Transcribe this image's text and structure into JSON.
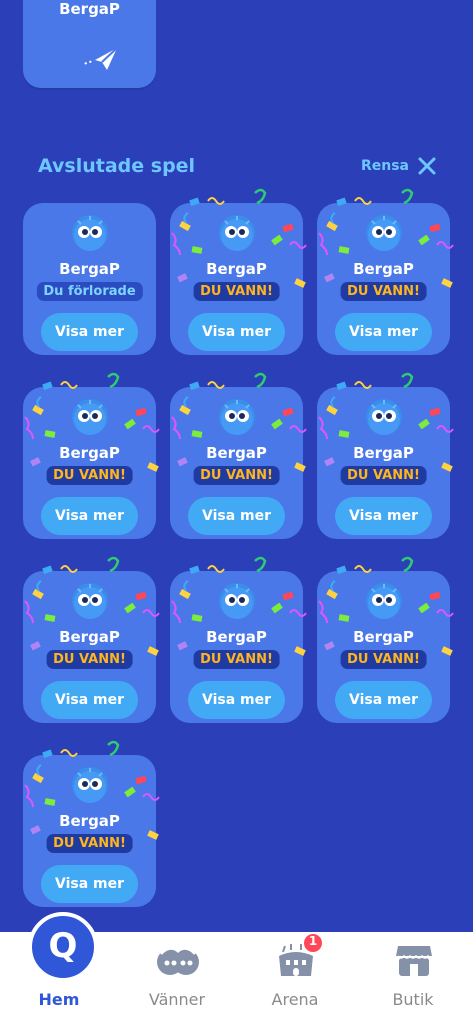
{
  "top_card": {
    "name": "BergaP"
  },
  "finished": {
    "title": "Avslutade spel",
    "clear_label": "Rensa",
    "games": [
      {
        "name": "BergaP",
        "result": "Du förlorade",
        "won": false,
        "button": "Visa mer"
      },
      {
        "name": "BergaP",
        "result": "DU VANN!",
        "won": true,
        "button": "Visa mer"
      },
      {
        "name": "BergaP",
        "result": "DU VANN!",
        "won": true,
        "button": "Visa mer"
      },
      {
        "name": "BergaP",
        "result": "DU VANN!",
        "won": true,
        "button": "Visa mer"
      },
      {
        "name": "BergaP",
        "result": "DU VANN!",
        "won": true,
        "button": "Visa mer"
      },
      {
        "name": "BergaP",
        "result": "DU VANN!",
        "won": true,
        "button": "Visa mer"
      },
      {
        "name": "BergaP",
        "result": "DU VANN!",
        "won": true,
        "button": "Visa mer"
      },
      {
        "name": "BergaP",
        "result": "DU VANN!",
        "won": true,
        "button": "Visa mer"
      },
      {
        "name": "BergaP",
        "result": "DU VANN!",
        "won": true,
        "button": "Visa mer"
      },
      {
        "name": "BergaP",
        "result": "DU VANN!",
        "won": true,
        "button": "Visa mer"
      }
    ]
  },
  "nav": {
    "home": {
      "label": "Hem",
      "icon": "q-logo-icon",
      "glyph": "Q"
    },
    "friends": {
      "label": "Vänner",
      "icon": "friends-icon"
    },
    "arena": {
      "label": "Arena",
      "icon": "arena-icon",
      "badge": "1"
    },
    "shop": {
      "label": "Butik",
      "icon": "shop-icon"
    }
  },
  "colors": {
    "background": "#2a3fb8",
    "card": "#4a78e8",
    "accent": "#6ec6ff",
    "button": "#42a9f5",
    "win_text": "#ffb51f",
    "badge": "#ff4757"
  }
}
